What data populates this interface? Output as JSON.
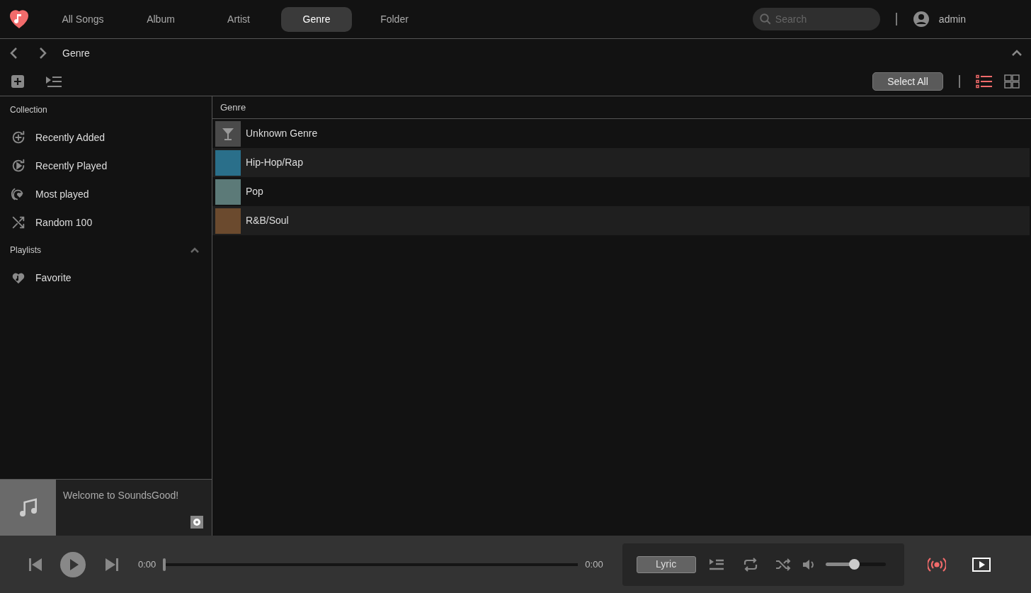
{
  "tabs": [
    {
      "label": "All Songs",
      "selected": false
    },
    {
      "label": "Album",
      "selected": false
    },
    {
      "label": "Artist",
      "selected": false
    },
    {
      "label": "Genre",
      "selected": true
    },
    {
      "label": "Folder",
      "selected": false
    }
  ],
  "search": {
    "placeholder": "Search"
  },
  "user": {
    "name": "admin"
  },
  "breadcrumb": "Genre",
  "select_all": "Select All",
  "view_modes": [
    {
      "kind": "list",
      "selected": true
    },
    {
      "kind": "grid",
      "selected": false
    }
  ],
  "sidebar": {
    "sections": [
      {
        "title": "Collection",
        "collapsible": false,
        "items": [
          {
            "kind": "added",
            "label": "Recently Added"
          },
          {
            "kind": "played",
            "label": "Recently Played"
          },
          {
            "kind": "most",
            "label": "Most played"
          },
          {
            "kind": "random",
            "label": "Random 100"
          }
        ]
      },
      {
        "title": "Playlists",
        "collapsible": true,
        "items": [
          {
            "kind": "favorite",
            "label": "Favorite"
          }
        ]
      }
    ]
  },
  "now_playing": {
    "message": "Welcome to SoundsGood!"
  },
  "table": {
    "columns": [
      "Genre"
    ],
    "rows": [
      {
        "kind": "placeholder",
        "name": "Unknown Genre"
      },
      {
        "kind": "cover",
        "name": "Hip-Hop/Rap",
        "color": "#2a6f8a"
      },
      {
        "kind": "cover",
        "name": "Pop",
        "color": "#5c7a78"
      },
      {
        "kind": "cover",
        "name": "R&B/Soul",
        "color": "#6b4a2e"
      }
    ]
  },
  "player": {
    "elapsed": "0:00",
    "total": "0:00",
    "progress": {
      "level": 0
    },
    "lyric": "Lyric",
    "volume": {
      "level": 0.49
    }
  }
}
